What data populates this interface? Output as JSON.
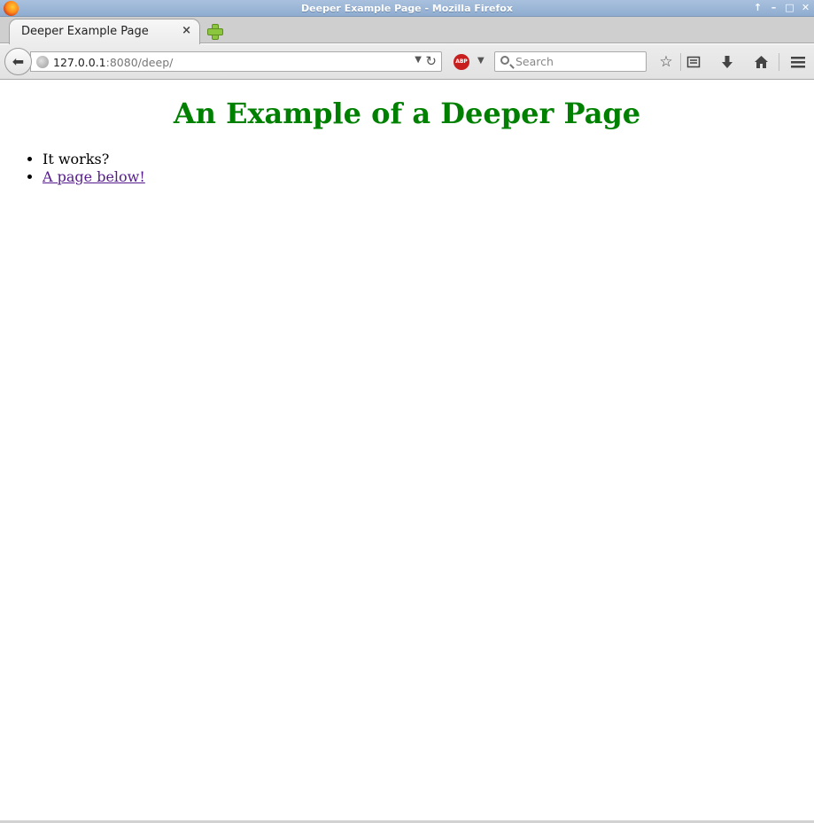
{
  "window": {
    "title": "Deeper Example Page - Mozilla Firefox",
    "controls": [
      "↑",
      "–",
      "□",
      "✕"
    ]
  },
  "tabs": [
    {
      "label": "Deeper Example Page",
      "close": "×"
    }
  ],
  "navbar": {
    "url_host": "127.0.0.1",
    "url_rest": ":8080/deep/",
    "abp_label": "ABP",
    "search_placeholder": "Search"
  },
  "page": {
    "heading": "An Example of a Deeper Page",
    "items": [
      {
        "text": "It works?"
      },
      {
        "text": "A page below!"
      }
    ],
    "heading_color": "#008000",
    "link_color": "#551a8b"
  }
}
